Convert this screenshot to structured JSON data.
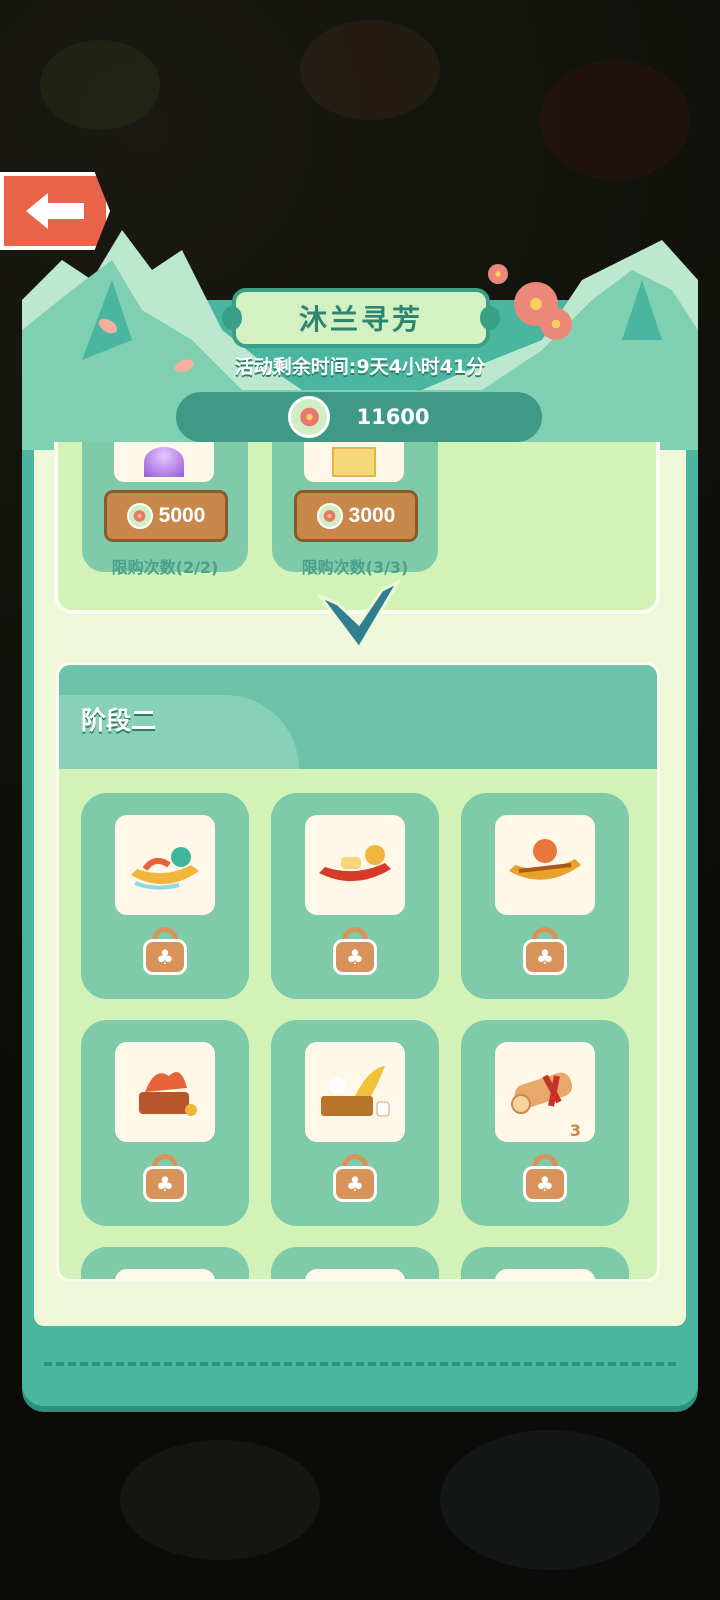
{
  "event": {
    "title": "沐兰寻芳",
    "timer": "活动剩余时间:9天4小时41分",
    "currency_amount": "11600",
    "currency_icon": "orchid-coin-icon"
  },
  "stage1": {
    "items": [
      {
        "icon": "purple-orb-icon",
        "price": "5000",
        "limit": "限购次数(2/2)"
      },
      {
        "icon": "gift-box-icon",
        "price": "3000",
        "limit": "限购次数(3/3)"
      }
    ]
  },
  "stage2": {
    "title": "阶段二",
    "items": [
      {
        "icon": "jade-dragon-boat-icon",
        "count": "",
        "locked": true
      },
      {
        "icon": "red-dragon-boat-icon",
        "count": "",
        "locked": true
      },
      {
        "icon": "golden-dragon-boat-icon",
        "count": "",
        "locked": true
      },
      {
        "icon": "dragon-throne-icon",
        "count": "",
        "locked": true
      },
      {
        "icon": "dragon-boat-stall-icon",
        "count": "",
        "locked": true
      },
      {
        "icon": "scroll-icon",
        "count": "3",
        "locked": true
      },
      {
        "icon": "hidden-item-icon",
        "count": "",
        "locked": true
      },
      {
        "icon": "hidden-item-icon",
        "count": "",
        "locked": true
      },
      {
        "icon": "hidden-item-icon",
        "count": "",
        "locked": true
      }
    ]
  },
  "colors": {
    "panel": "#4ab6a0",
    "accent_orange": "#d7935a",
    "price_button": "#c8884a",
    "back_button": "#e8634a"
  }
}
